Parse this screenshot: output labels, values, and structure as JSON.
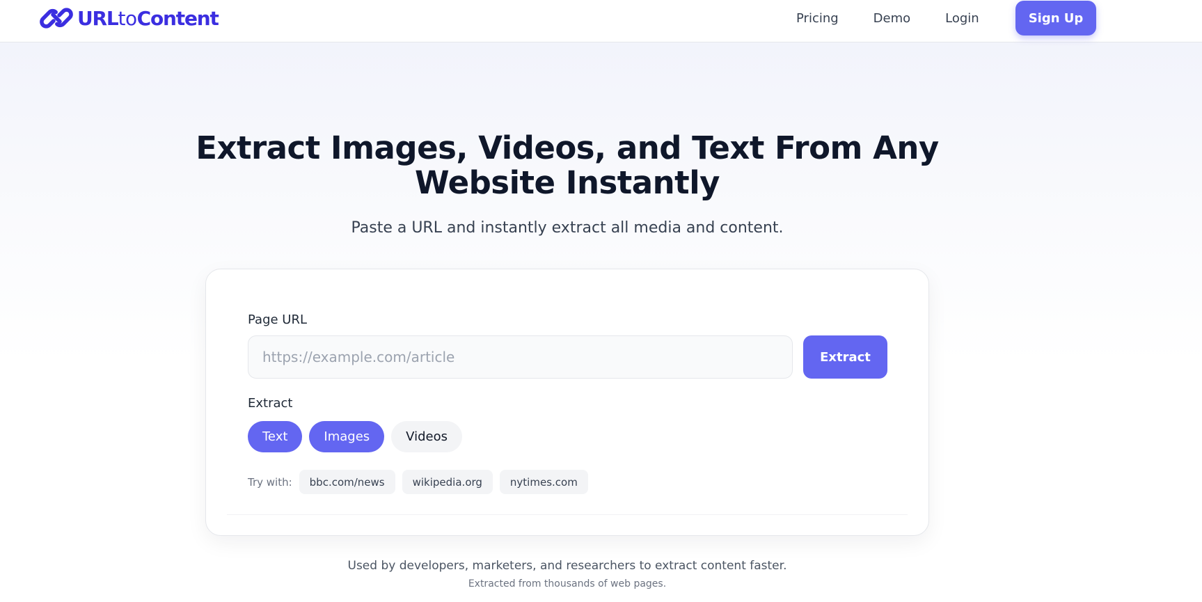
{
  "brand": {
    "logo_icon": "chain-link-icon",
    "name_part1": "URL",
    "name_part2": "to",
    "name_part3": "Content",
    "color": "#3b2ee0"
  },
  "nav": {
    "items": [
      {
        "label": "Pricing"
      },
      {
        "label": "Demo"
      },
      {
        "label": "Login"
      }
    ],
    "signup_label": "Sign Up"
  },
  "hero": {
    "title_line1": "Extract Images, Videos, and Text From Any",
    "title_line2": "Website Instantly",
    "subtitle": "Paste a URL and instantly extract all media and content."
  },
  "form": {
    "url_label": "Page URL",
    "url_value": "",
    "url_placeholder": "https://example.com/article",
    "extract_button": "Extract",
    "extract_label": "Extract",
    "types": [
      {
        "label": "Text",
        "selected": true
      },
      {
        "label": "Images",
        "selected": true
      },
      {
        "label": "Videos",
        "selected": false
      }
    ],
    "try_label": "Try with:",
    "examples": [
      "bbc.com/news",
      "wikipedia.org",
      "nytimes.com"
    ]
  },
  "footer": {
    "tagline": "Used by developers, marketers, and researchers to extract content faster.",
    "subline": "Extracted from thousands of web pages."
  },
  "colors": {
    "accent": "#6366f1",
    "heading": "#0f172a"
  }
}
